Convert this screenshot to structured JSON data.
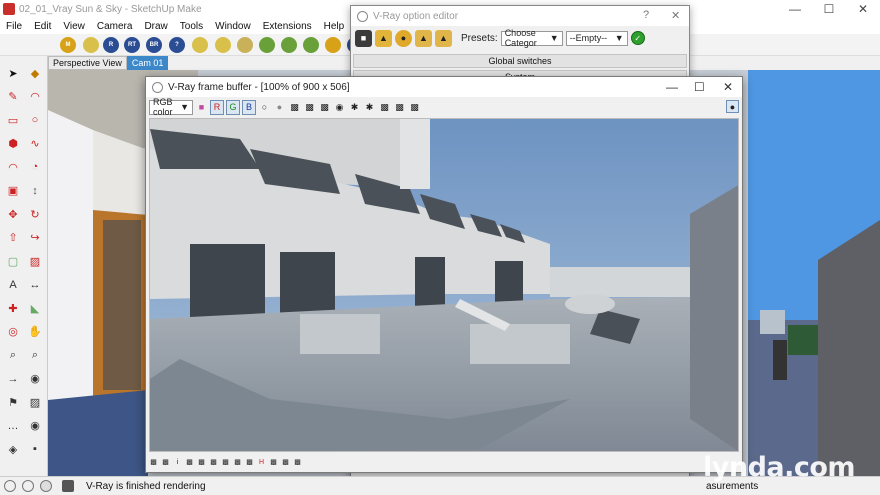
{
  "sketchup": {
    "title": "02_01_Vray Sun & Sky - SketchUp Make",
    "menus": [
      "File",
      "Edit",
      "View",
      "Camera",
      "Draw",
      "Tools",
      "Window",
      "Extensions",
      "Help"
    ],
    "scene_tabs": [
      "Perspective View",
      "Cam 01"
    ],
    "active_tab": "Cam 01",
    "toolbar_buttons": [
      {
        "label": "M",
        "color": "#d7a217"
      },
      {
        "label": "",
        "color": "#d8c04a"
      },
      {
        "label": "R",
        "color": "#2b4d93"
      },
      {
        "label": "RT",
        "color": "#2b4d93"
      },
      {
        "label": "BR",
        "color": "#2b4d93"
      },
      {
        "label": "?",
        "color": "#2b4d93"
      },
      {
        "label": "",
        "color": "#d8c04a"
      },
      {
        "label": "",
        "color": "#d8c04a"
      },
      {
        "label": "",
        "color": "#c9b15a"
      },
      {
        "label": "",
        "color": "#6aa03a"
      },
      {
        "label": "",
        "color": "#6aa03a"
      },
      {
        "label": "",
        "color": "#6aa03a"
      },
      {
        "label": "",
        "color": "#d7a217"
      },
      {
        "label": "II",
        "color": "#2b4d93"
      }
    ],
    "status_text": "V-Ray is finished rendering",
    "measurements_label": "asurements",
    "watermark": "lynda.com"
  },
  "option_editor": {
    "title": "V-Ray option editor",
    "presets_label": "Presets:",
    "category_value": "Choose Categor",
    "preset_value": "--Empty--",
    "sections": [
      "Global switches",
      "System"
    ]
  },
  "frame_buffer": {
    "title": "V-Ray frame buffer - [100% of 900 x 506]",
    "channel_value": "RGB color",
    "channel_buttons": [
      "R",
      "G",
      "B"
    ]
  }
}
